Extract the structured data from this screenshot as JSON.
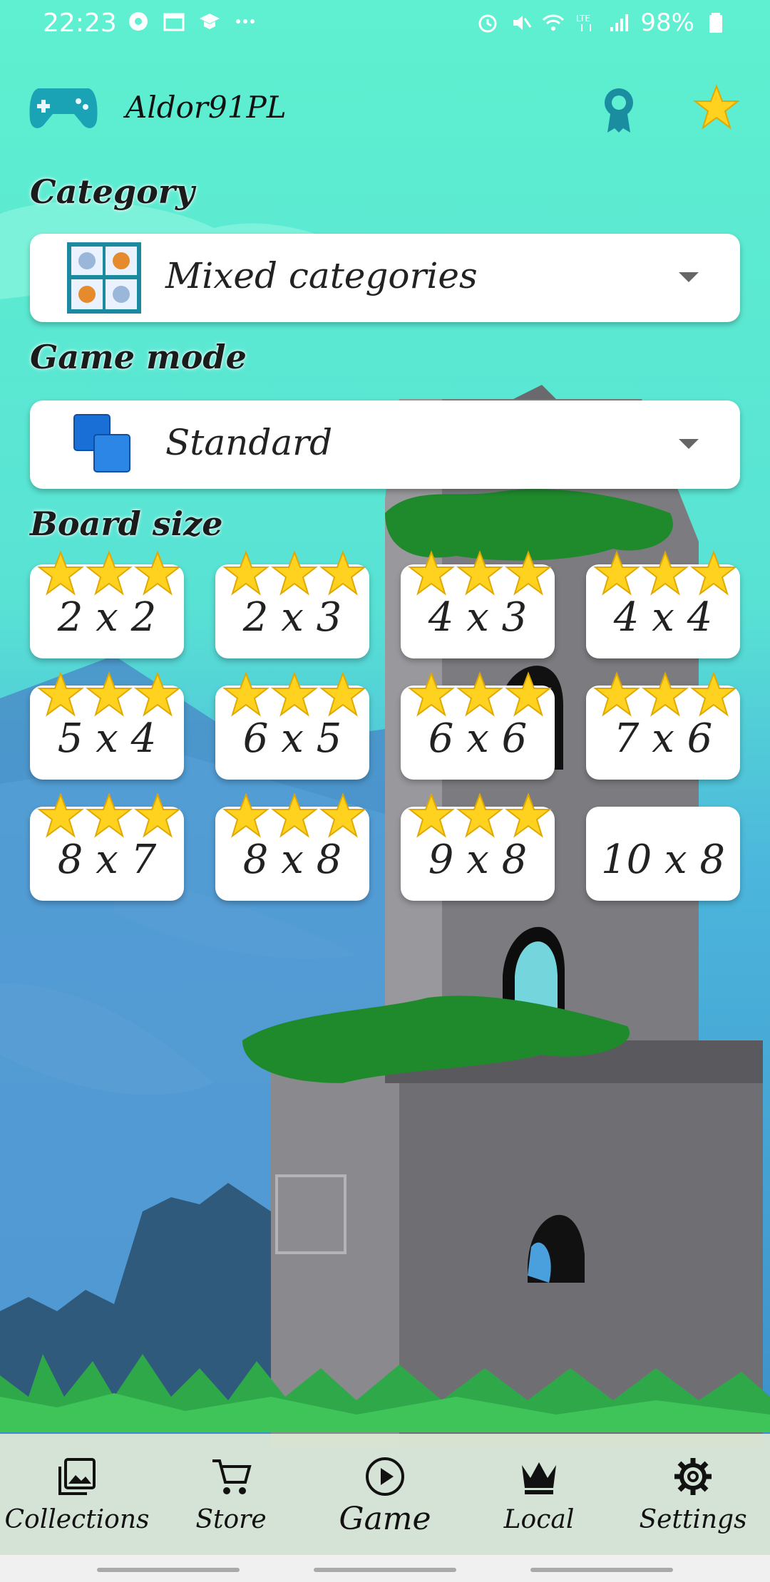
{
  "status_bar": {
    "time": "22:23",
    "battery": "98%",
    "icons_left": [
      "app-notification-icon",
      "calendar-icon",
      "graduation-cap-icon",
      "more-dots-icon"
    ],
    "icons_right": [
      "alarm-icon",
      "mute-icon",
      "wifi-icon",
      "lte-icon",
      "signal-icon",
      "battery-icon"
    ]
  },
  "header": {
    "username": "Aldor91PL",
    "icons": [
      "gamepad-icon",
      "medal-icon",
      "star-icon"
    ]
  },
  "category": {
    "label": "Category",
    "selected": "Mixed categories"
  },
  "game_mode": {
    "label": "Game mode",
    "selected": "Standard"
  },
  "board_size": {
    "label": "Board size",
    "tiles": [
      {
        "label": "2 x 2",
        "stars": 3
      },
      {
        "label": "2 x 3",
        "stars": 3
      },
      {
        "label": "4 x 3",
        "stars": 3
      },
      {
        "label": "4 x 4",
        "stars": 3
      },
      {
        "label": "5 x 4",
        "stars": 3
      },
      {
        "label": "6 x 5",
        "stars": 3
      },
      {
        "label": "6 x 6",
        "stars": 3
      },
      {
        "label": "7 x 6",
        "stars": 3
      },
      {
        "label": "8 x 7",
        "stars": 3
      },
      {
        "label": "8 x 8",
        "stars": 3
      },
      {
        "label": "9 x 8",
        "stars": 3
      },
      {
        "label": "10 x 8",
        "stars": 0
      }
    ]
  },
  "bottom_nav": {
    "items": [
      {
        "label": "Collections",
        "icon": "collections-icon"
      },
      {
        "label": "Store",
        "icon": "cart-icon"
      },
      {
        "label": "Game",
        "icon": "play-icon",
        "active": true
      },
      {
        "label": "Local",
        "icon": "crown-icon"
      },
      {
        "label": "Settings",
        "icon": "gear-icon"
      }
    ]
  },
  "colors": {
    "sky_top": "#5ef2cf",
    "sky_bottom": "#3a8fd0",
    "star_fill": "#ffd21f",
    "tower_gray": "#6f6f73"
  }
}
